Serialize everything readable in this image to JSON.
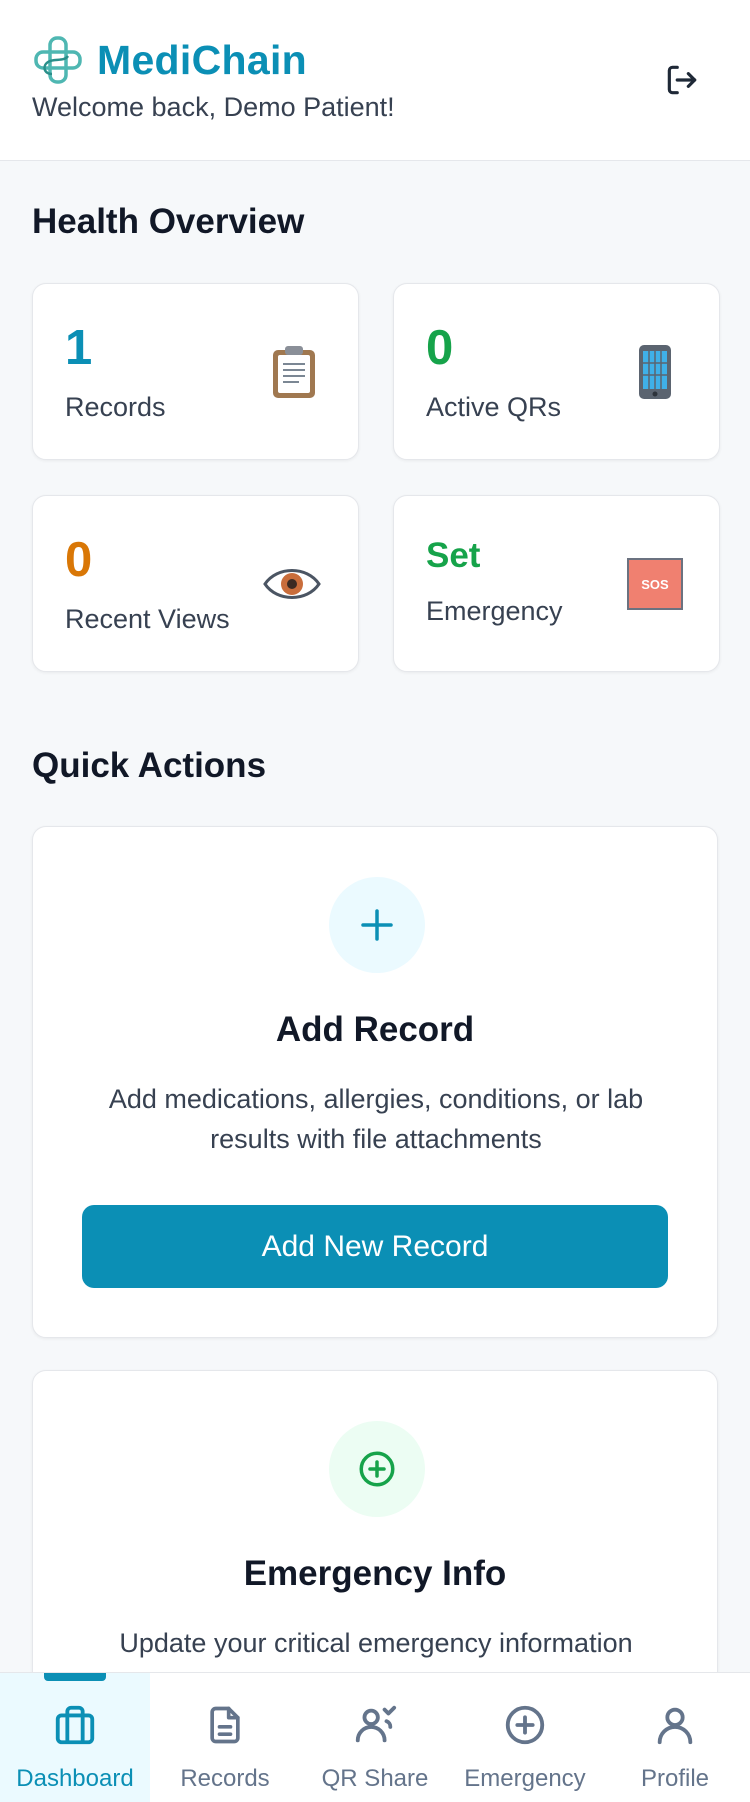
{
  "header": {
    "brand": "MediChain",
    "welcome": "Welcome back, Demo Patient!",
    "logout_icon": "logout-icon"
  },
  "overview": {
    "title": "Health Overview",
    "cards": [
      {
        "value": "1",
        "label": "Records",
        "icon": "clipboard-icon",
        "color": "#0b8fb5"
      },
      {
        "value": "0",
        "label": "Active QRs",
        "icon": "mobile-phone-icon",
        "color": "#16a34a"
      },
      {
        "value": "0",
        "label": "Recent Views",
        "icon": "eye-icon",
        "color": "#d97706"
      },
      {
        "value": "Set",
        "label": "Emergency",
        "icon": "sos-icon",
        "color": "#16a34a"
      }
    ]
  },
  "quick_actions": {
    "title": "Quick Actions",
    "add_record": {
      "icon": "plus-icon",
      "title": "Add Record",
      "description": "Add medications, allergies, conditions, or lab results with file attachments",
      "button": "Add New Record"
    },
    "emergency": {
      "icon": "plus-circle-icon",
      "title": "Emergency Info",
      "description": "Update your critical emergency information"
    }
  },
  "nav": {
    "items": [
      {
        "label": "Dashboard",
        "icon": "dashboard-icon",
        "active": true
      },
      {
        "label": "Records",
        "icon": "document-icon",
        "active": false
      },
      {
        "label": "QR Share",
        "icon": "qr-share-icon",
        "active": false
      },
      {
        "label": "Emergency",
        "icon": "plus-circle-icon",
        "active": false
      },
      {
        "label": "Profile",
        "icon": "user-icon",
        "active": false
      }
    ]
  },
  "colors": {
    "accent": "#0b8fb5",
    "green": "#16a34a",
    "orange": "#d97706",
    "background": "#f6f8fa"
  }
}
